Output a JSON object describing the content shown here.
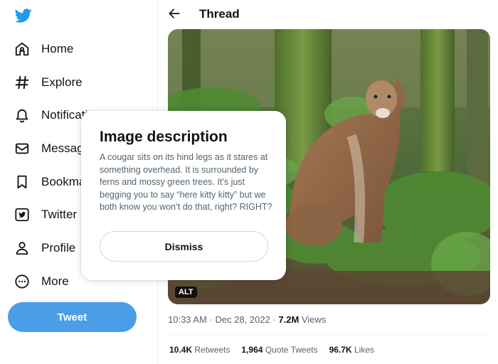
{
  "sidebar": {
    "items": [
      {
        "label": "Home",
        "icon": "home-icon"
      },
      {
        "label": "Explore",
        "icon": "hashtag-icon"
      },
      {
        "label": "Notifications",
        "icon": "bell-icon"
      },
      {
        "label": "Messages",
        "icon": "envelope-icon"
      },
      {
        "label": "Bookmarks",
        "icon": "bookmark-icon"
      },
      {
        "label": "Twitter Blue",
        "icon": "twitter-square-icon"
      },
      {
        "label": "Profile",
        "icon": "person-icon"
      },
      {
        "label": "More",
        "icon": "more-circle-icon"
      }
    ],
    "tweet_label": "Tweet"
  },
  "header": {
    "title": "Thread"
  },
  "tweet": {
    "alt_badge": "ALT",
    "time": "10:33 AM · Dec 28, 2022 · ",
    "views_count": "7.2M",
    "views_label": " Views",
    "retweets_count": "10.4K",
    "retweets_label": " Retweets",
    "quotes_count": "1,964",
    "quotes_label": " Quote Tweets",
    "likes_count": "96.7K",
    "likes_label": " Likes"
  },
  "popup": {
    "title": "Image description",
    "description": "A cougar sits on its hind legs as it stares at something overhead. It is surrounded by ferns and mossy green trees. It’s just begging you to say “here kitty kitty” but we both know you won’t do that, right? RIGHT?",
    "dismiss_label": "Dismiss"
  },
  "colors": {
    "brand": "#1d9bf0",
    "tweet_button": "#4a9ee8",
    "text_secondary": "#536471"
  }
}
